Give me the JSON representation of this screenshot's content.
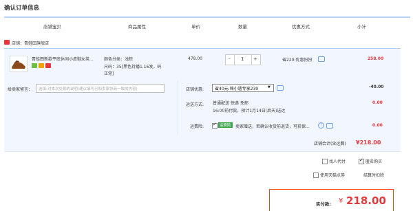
{
  "page": {
    "title": "确认订单信息"
  },
  "table_header": {
    "columns": [
      "店铺宝贝",
      "商品属性",
      "单价",
      "数量",
      "优惠方式",
      "小计"
    ]
  },
  "shop": {
    "name": "店铺：青蛙田旗舰店"
  },
  "item": {
    "name_line1": "青蛙田新款平底休闲小皮鞋女英...",
    "attr_color": "颜色分类：浅棕",
    "attr_size_line1": "尺码：35[黑色持播1.16发，码",
    "attr_size_line2": "正常]",
    "unit_price": "478.00",
    "quantity": "1",
    "qty_minus": "-",
    "qty_plus": "+",
    "promo": "省220:优惠扮扮",
    "subtotal": "258.00",
    "badge_colors": [
      "#6cbf3c",
      "#f0a000",
      "#e4393c"
    ]
  },
  "memo": {
    "label": "给卖家留言：",
    "placeholder": "选填:对本次交易的说明(建议填写已和卖家协商一致的内容)"
  },
  "shop_discount": {
    "label": "店铺优惠:",
    "selected": "省40元:嗨小遗专享239",
    "amount": "-40.00"
  },
  "shipping": {
    "label": "运送方式:",
    "method": "普通配送 快递 免邮",
    "eta": "16:00前付款，预计1月14日(后天)送达",
    "amount": "0.00"
  },
  "insurance": {
    "label": "运费险:",
    "badge": "运费险",
    "text": "卖家赠送，若确认收货前退货，可获保...",
    "amount": "0.00"
  },
  "store_total": {
    "label": "店铺合计(含运费)",
    "value": "¥218.00"
  },
  "options": {
    "proxy_pay": "找人代付",
    "anonymous": "匿名购买",
    "tmall_points": "使用天猫点券",
    "installment": "结算时扣除"
  },
  "payable": {
    "label": "实付款:",
    "currency": "¥",
    "value": "218.00"
  }
}
